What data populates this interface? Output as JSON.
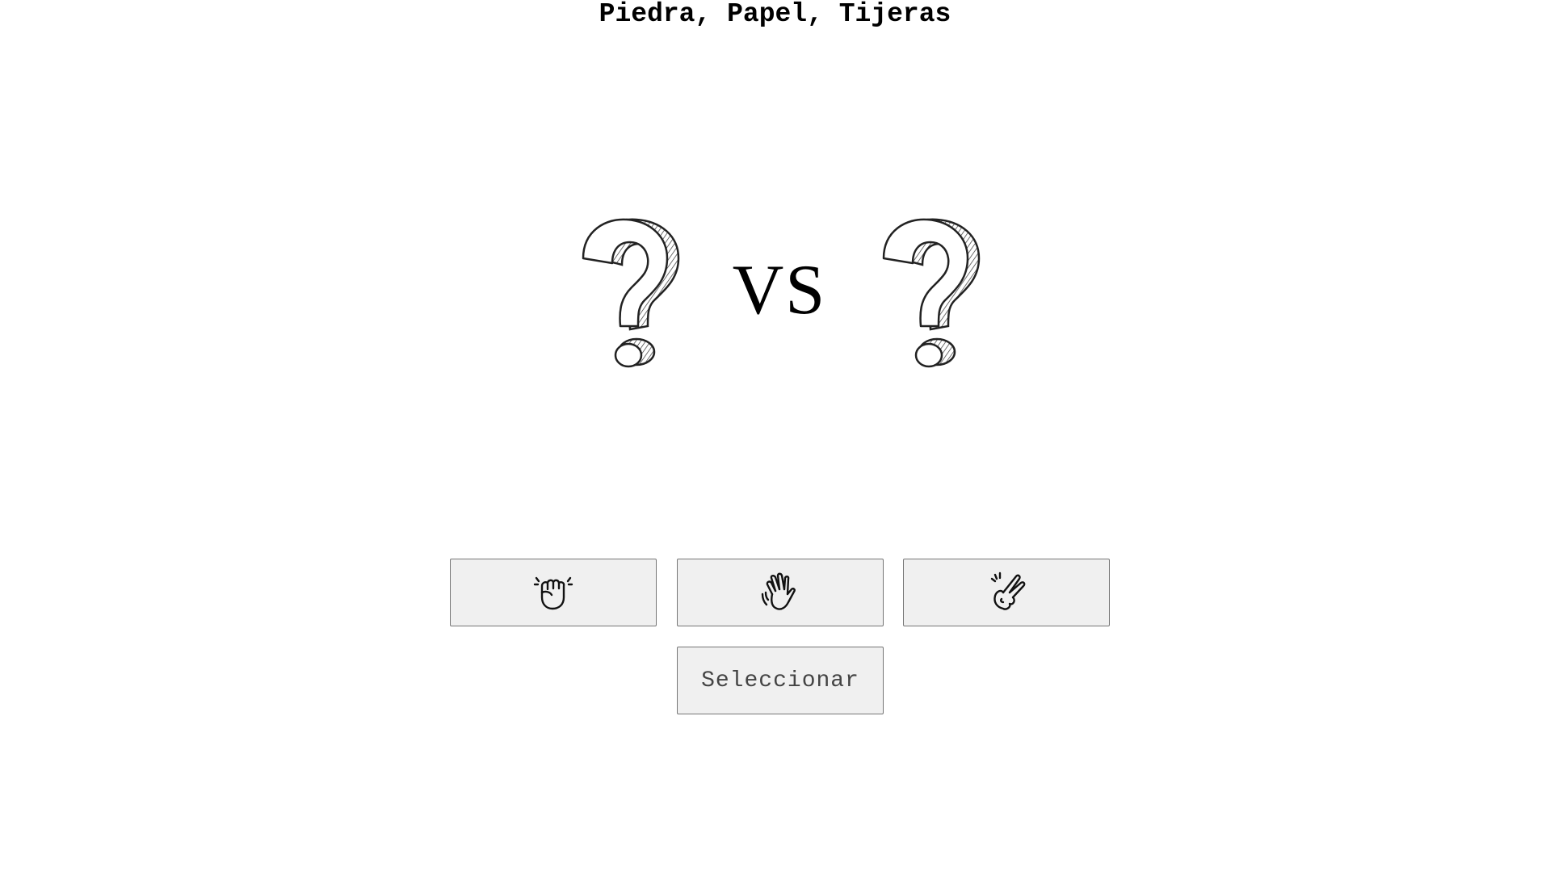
{
  "title": "Piedra, Papel, Tijeras",
  "arena": {
    "vs_label": "VS",
    "player_choice_icon": "question-mark-icon",
    "computer_choice_icon": "question-mark-icon"
  },
  "choices": [
    {
      "id": "rock",
      "icon": "fist-icon"
    },
    {
      "id": "paper",
      "icon": "open-hand-icon"
    },
    {
      "id": "scissors",
      "icon": "two-fingers-icon"
    }
  ],
  "select_label": "Seleccionar"
}
